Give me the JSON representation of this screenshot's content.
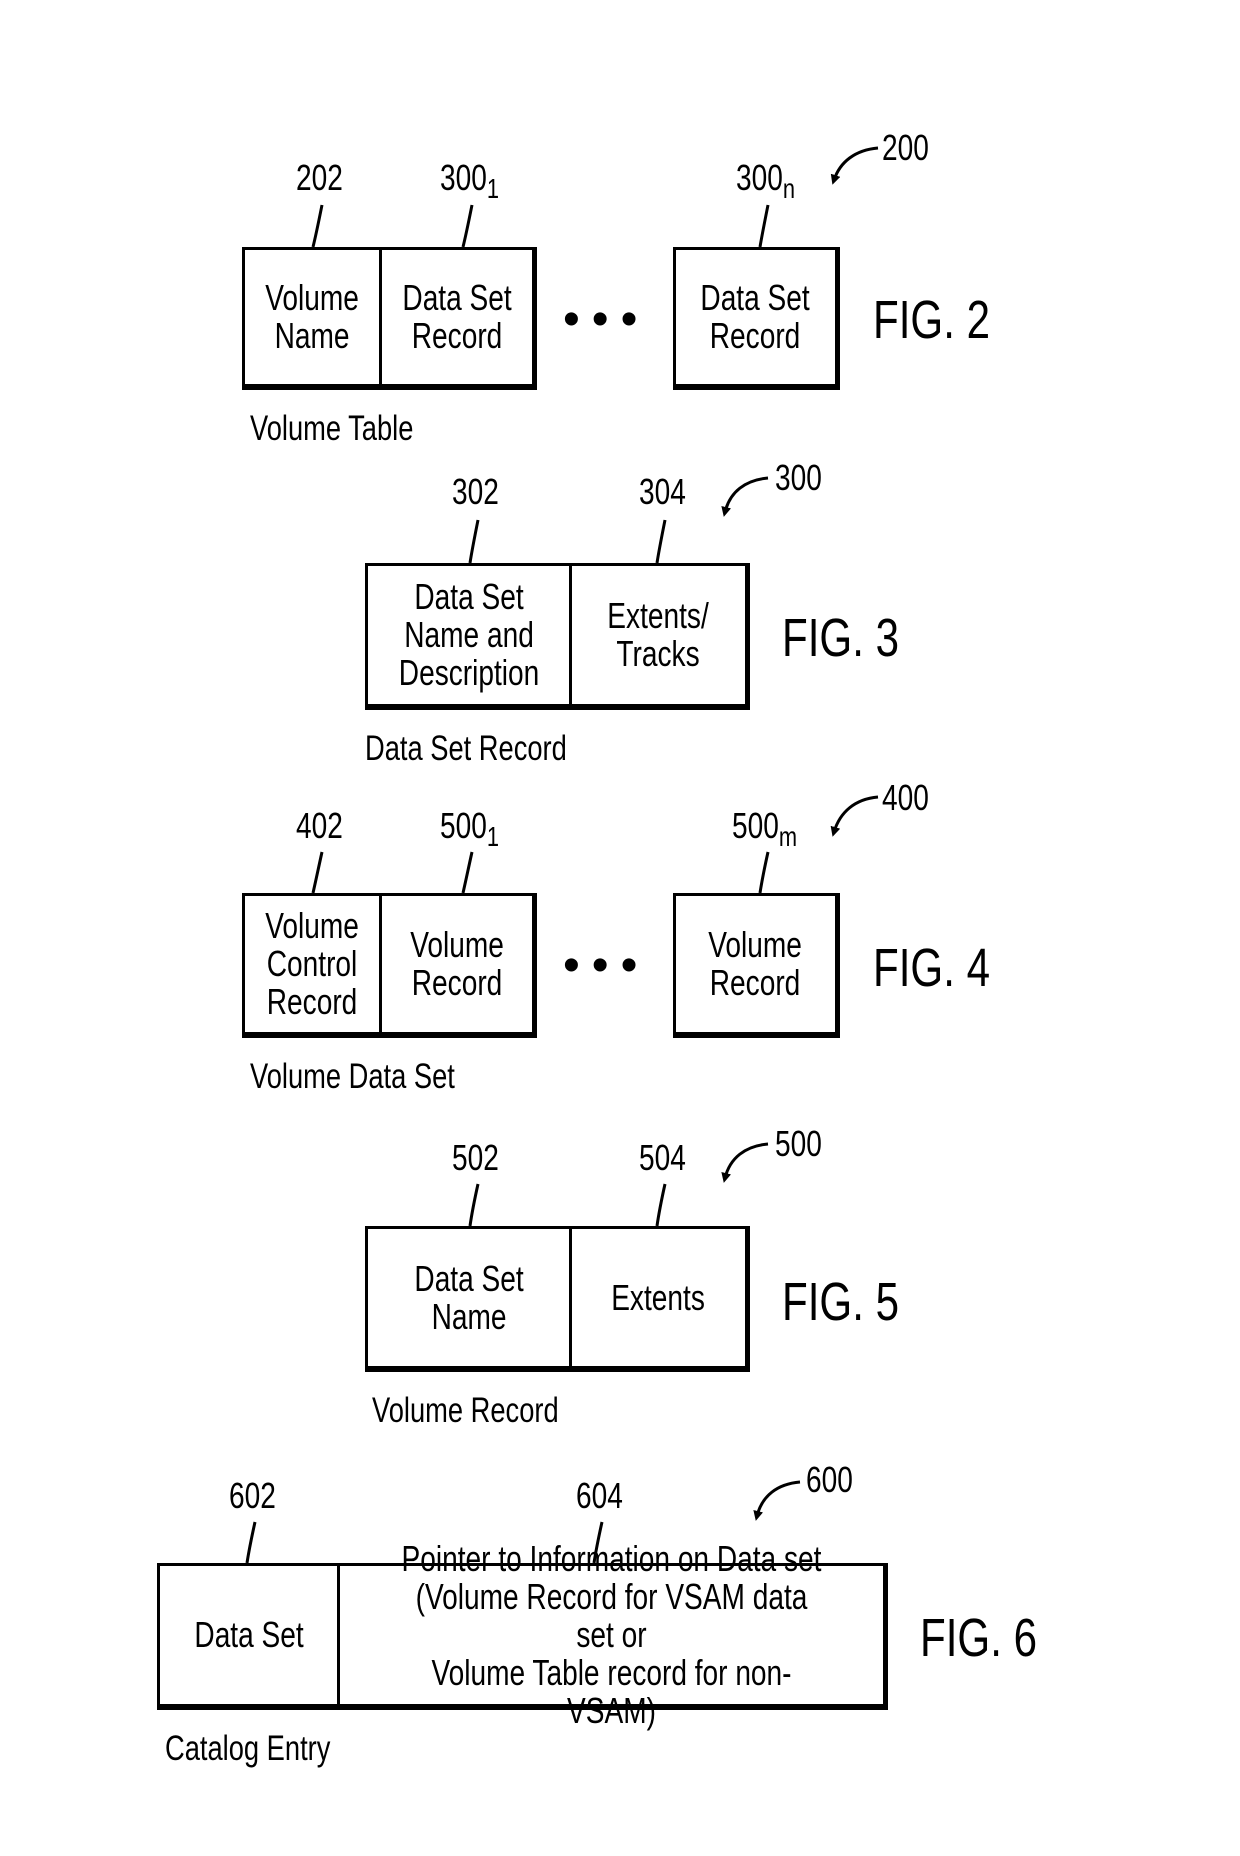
{
  "figures": {
    "fig2": {
      "label": "FIG. 2",
      "ref": "200",
      "caption": "Volume Table",
      "cells": [
        {
          "ref": "202",
          "ref_sub": "",
          "text": "Volume\nName"
        },
        {
          "ref": "300",
          "ref_sub": "1",
          "text": "Data Set\nRecord"
        },
        {
          "ref": "300",
          "ref_sub": "n",
          "text": "Data Set\nRecord"
        }
      ],
      "ellipsis": "•••"
    },
    "fig3": {
      "label": "FIG. 3",
      "ref": "300",
      "caption": "Data Set Record",
      "cells": [
        {
          "ref": "302",
          "text": "Data Set\nName and\nDescription"
        },
        {
          "ref": "304",
          "text": "Extents/\nTracks"
        }
      ]
    },
    "fig4": {
      "label": "FIG. 4",
      "ref": "400",
      "caption": "Volume Data Set",
      "cells": [
        {
          "ref": "402",
          "ref_sub": "",
          "text": "Volume\nControl\nRecord"
        },
        {
          "ref": "500",
          "ref_sub": "1",
          "text": "Volume\nRecord"
        },
        {
          "ref": "500",
          "ref_sub": "m",
          "text": "Volume\nRecord"
        }
      ],
      "ellipsis": "•••"
    },
    "fig5": {
      "label": "FIG. 5",
      "ref": "500",
      "caption": "Volume Record",
      "cells": [
        {
          "ref": "502",
          "text": "Data Set\nName"
        },
        {
          "ref": "504",
          "text": "Extents"
        }
      ]
    },
    "fig6": {
      "label": "FIG. 6",
      "ref": "600",
      "caption": "Catalog Entry",
      "cells": [
        {
          "ref": "602",
          "text": "Data Set"
        },
        {
          "ref": "604",
          "text": "Pointer to Information on Data set\n(Volume Record for VSAM data set or\nVolume Table record for non-VSAM)"
        }
      ]
    }
  }
}
